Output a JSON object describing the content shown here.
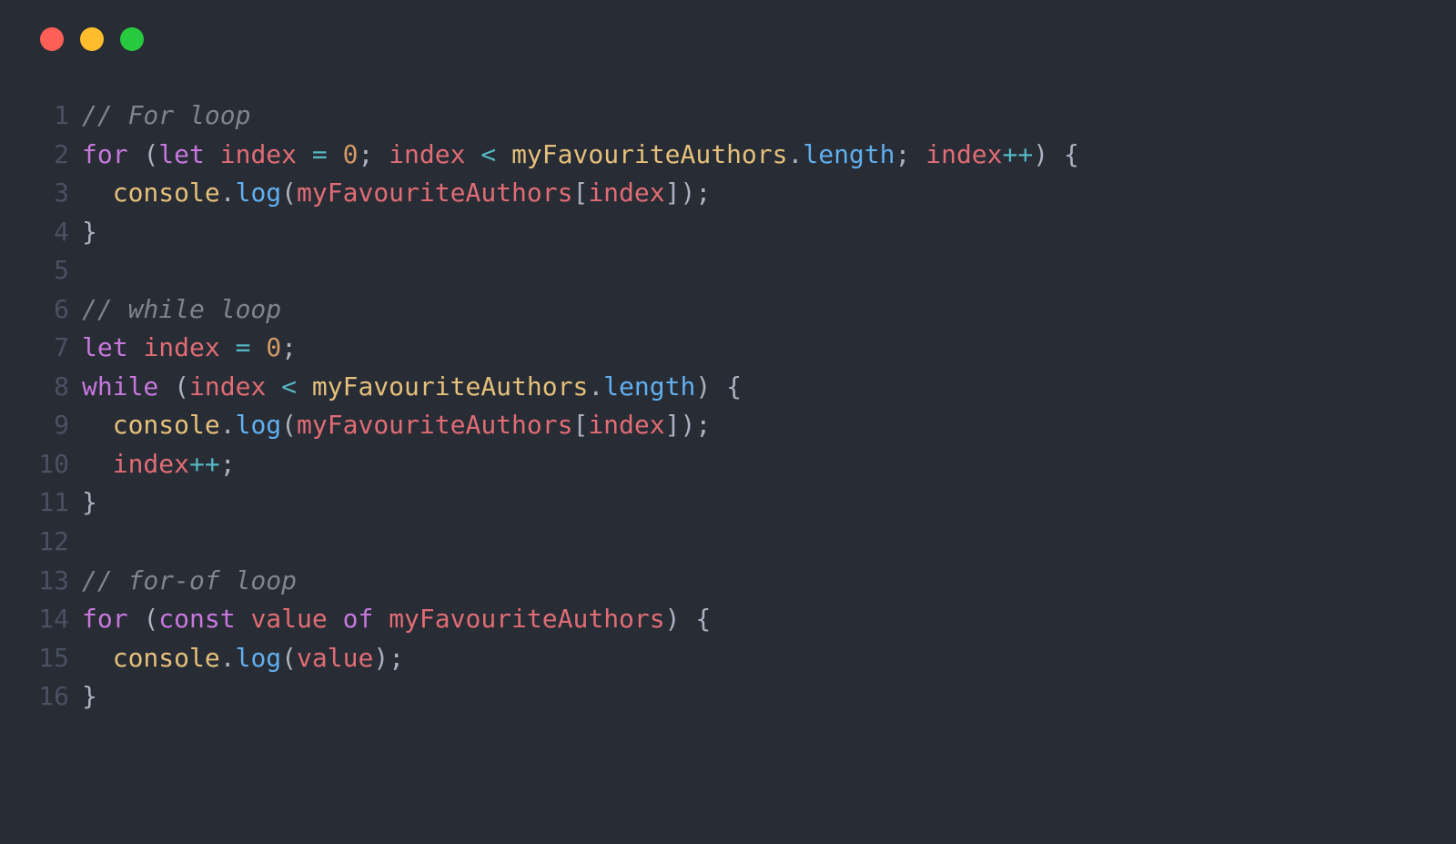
{
  "windowControls": [
    "red",
    "yellow",
    "green"
  ],
  "lines": [
    {
      "n": 1,
      "tokens": [
        [
          "c-comment",
          "// For loop"
        ]
      ]
    },
    {
      "n": 2,
      "tokens": [
        [
          "c-keyword",
          "for"
        ],
        [
          "c-punc",
          " "
        ],
        [
          "c-paren",
          "("
        ],
        [
          "c-storage",
          "let"
        ],
        [
          "c-punc",
          " "
        ],
        [
          "c-ident",
          "index"
        ],
        [
          "c-punc",
          " "
        ],
        [
          "c-op",
          "="
        ],
        [
          "c-punc",
          " "
        ],
        [
          "c-num",
          "0"
        ],
        [
          "c-semi",
          ";"
        ],
        [
          "c-punc",
          " "
        ],
        [
          "c-ident",
          "index"
        ],
        [
          "c-punc",
          " "
        ],
        [
          "c-op",
          "<"
        ],
        [
          "c-punc",
          " "
        ],
        [
          "c-obj",
          "myFavouriteAuthors"
        ],
        [
          "c-dot",
          "."
        ],
        [
          "c-method",
          "length"
        ],
        [
          "c-semi",
          ";"
        ],
        [
          "c-punc",
          " "
        ],
        [
          "c-ident",
          "index"
        ],
        [
          "c-op",
          "++"
        ],
        [
          "c-paren",
          ")"
        ],
        [
          "c-punc",
          " "
        ],
        [
          "c-brace",
          "{"
        ]
      ]
    },
    {
      "n": 3,
      "tokens": [
        [
          "c-punc",
          "  "
        ],
        [
          "c-obj",
          "console"
        ],
        [
          "c-dot",
          "."
        ],
        [
          "c-method",
          "log"
        ],
        [
          "c-paren",
          "("
        ],
        [
          "c-ident",
          "myFavouriteAuthors"
        ],
        [
          "c-bracket",
          "["
        ],
        [
          "c-ident",
          "index"
        ],
        [
          "c-bracket",
          "]"
        ],
        [
          "c-paren",
          ")"
        ],
        [
          "c-semi",
          ";"
        ]
      ]
    },
    {
      "n": 4,
      "tokens": [
        [
          "c-brace",
          "}"
        ]
      ]
    },
    {
      "n": 5,
      "tokens": []
    },
    {
      "n": 6,
      "tokens": [
        [
          "c-comment",
          "// while loop"
        ]
      ]
    },
    {
      "n": 7,
      "tokens": [
        [
          "c-storage",
          "let"
        ],
        [
          "c-punc",
          " "
        ],
        [
          "c-ident",
          "index"
        ],
        [
          "c-punc",
          " "
        ],
        [
          "c-op",
          "="
        ],
        [
          "c-punc",
          " "
        ],
        [
          "c-num",
          "0"
        ],
        [
          "c-semi",
          ";"
        ]
      ]
    },
    {
      "n": 8,
      "tokens": [
        [
          "c-keyword",
          "while"
        ],
        [
          "c-punc",
          " "
        ],
        [
          "c-paren",
          "("
        ],
        [
          "c-ident",
          "index"
        ],
        [
          "c-punc",
          " "
        ],
        [
          "c-op",
          "<"
        ],
        [
          "c-punc",
          " "
        ],
        [
          "c-obj",
          "myFavouriteAuthors"
        ],
        [
          "c-dot",
          "."
        ],
        [
          "c-method",
          "length"
        ],
        [
          "c-paren",
          ")"
        ],
        [
          "c-punc",
          " "
        ],
        [
          "c-brace",
          "{"
        ]
      ]
    },
    {
      "n": 9,
      "tokens": [
        [
          "c-punc",
          "  "
        ],
        [
          "c-obj",
          "console"
        ],
        [
          "c-dot",
          "."
        ],
        [
          "c-method",
          "log"
        ],
        [
          "c-paren",
          "("
        ],
        [
          "c-ident",
          "myFavouriteAuthors"
        ],
        [
          "c-bracket",
          "["
        ],
        [
          "c-ident",
          "index"
        ],
        [
          "c-bracket",
          "]"
        ],
        [
          "c-paren",
          ")"
        ],
        [
          "c-semi",
          ";"
        ]
      ]
    },
    {
      "n": 10,
      "tokens": [
        [
          "c-punc",
          "  "
        ],
        [
          "c-ident",
          "index"
        ],
        [
          "c-op",
          "++"
        ],
        [
          "c-semi",
          ";"
        ]
      ]
    },
    {
      "n": 11,
      "tokens": [
        [
          "c-brace",
          "}"
        ]
      ]
    },
    {
      "n": 12,
      "tokens": []
    },
    {
      "n": 13,
      "tokens": [
        [
          "c-comment",
          "// for-of loop"
        ]
      ]
    },
    {
      "n": 14,
      "tokens": [
        [
          "c-keyword",
          "for"
        ],
        [
          "c-punc",
          " "
        ],
        [
          "c-paren",
          "("
        ],
        [
          "c-storage",
          "const"
        ],
        [
          "c-punc",
          " "
        ],
        [
          "c-ident",
          "value"
        ],
        [
          "c-punc",
          " "
        ],
        [
          "c-keyword",
          "of"
        ],
        [
          "c-punc",
          " "
        ],
        [
          "c-ident",
          "myFavouriteAuthors"
        ],
        [
          "c-paren",
          ")"
        ],
        [
          "c-punc",
          " "
        ],
        [
          "c-brace",
          "{"
        ]
      ]
    },
    {
      "n": 15,
      "tokens": [
        [
          "c-punc",
          "  "
        ],
        [
          "c-obj",
          "console"
        ],
        [
          "c-dot",
          "."
        ],
        [
          "c-method",
          "log"
        ],
        [
          "c-paren",
          "("
        ],
        [
          "c-ident",
          "value"
        ],
        [
          "c-paren",
          ")"
        ],
        [
          "c-semi",
          ";"
        ]
      ]
    },
    {
      "n": 16,
      "tokens": [
        [
          "c-brace",
          "}"
        ]
      ]
    }
  ]
}
